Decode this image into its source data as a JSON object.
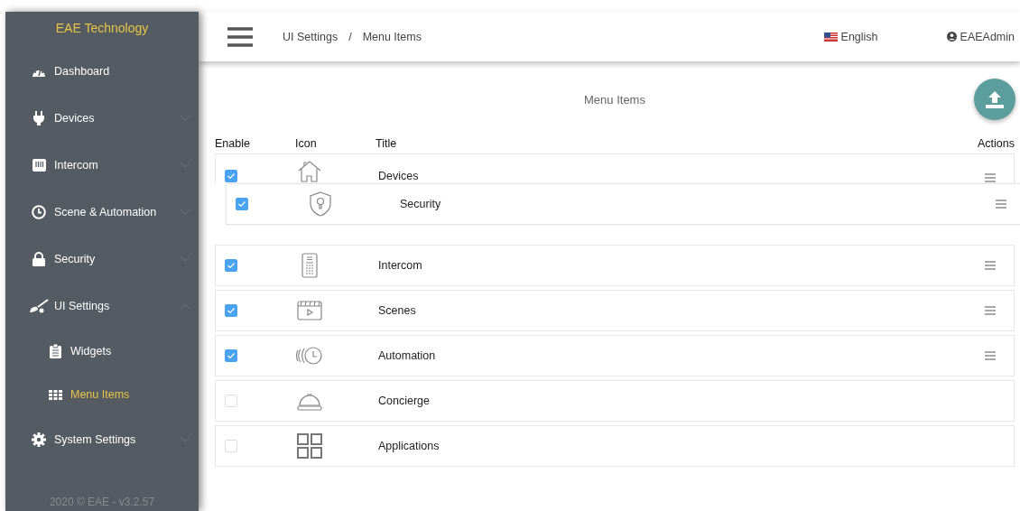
{
  "sidebar": {
    "brand": "EAE Technology",
    "items": [
      {
        "label": "Dashboard",
        "selected": false
      },
      {
        "label": "Devices",
        "selected": false,
        "expanded": false
      },
      {
        "label": "Intercom",
        "selected": false,
        "expanded": false
      },
      {
        "label": "Scene & Automation",
        "selected": false,
        "expanded": false
      },
      {
        "label": "Security",
        "selected": false,
        "expanded": false
      },
      {
        "label": "UI Settings",
        "selected": false,
        "expanded": true,
        "children": [
          {
            "label": "Widgets",
            "selected": false
          },
          {
            "label": "Menu Items",
            "selected": true
          }
        ]
      },
      {
        "label": "System Settings",
        "selected": false,
        "expanded": false
      }
    ],
    "footer": "2020 © EAE - v3.2.57"
  },
  "header": {
    "breadcrumb": [
      "UI Settings",
      "/",
      "Menu Items"
    ],
    "language": "English",
    "user": "EAEAdmin"
  },
  "page_title": "Menu Items",
  "table": {
    "columns": [
      "Enable",
      "Icon",
      "Title",
      "Actions"
    ],
    "rows": [
      {
        "title": "Devices",
        "checked": true,
        "dragging": false
      },
      {
        "title": "Security",
        "checked": true,
        "dragging": true
      },
      {
        "title": "Intercom",
        "checked": true,
        "dragging": false
      },
      {
        "title": "Scenes",
        "checked": true,
        "dragging": false
      },
      {
        "title": "Automation",
        "checked": true,
        "dragging": false
      },
      {
        "title": "Concierge",
        "checked": false,
        "dragging": false
      },
      {
        "title": "Applications",
        "checked": false,
        "dragging": false
      }
    ]
  }
}
